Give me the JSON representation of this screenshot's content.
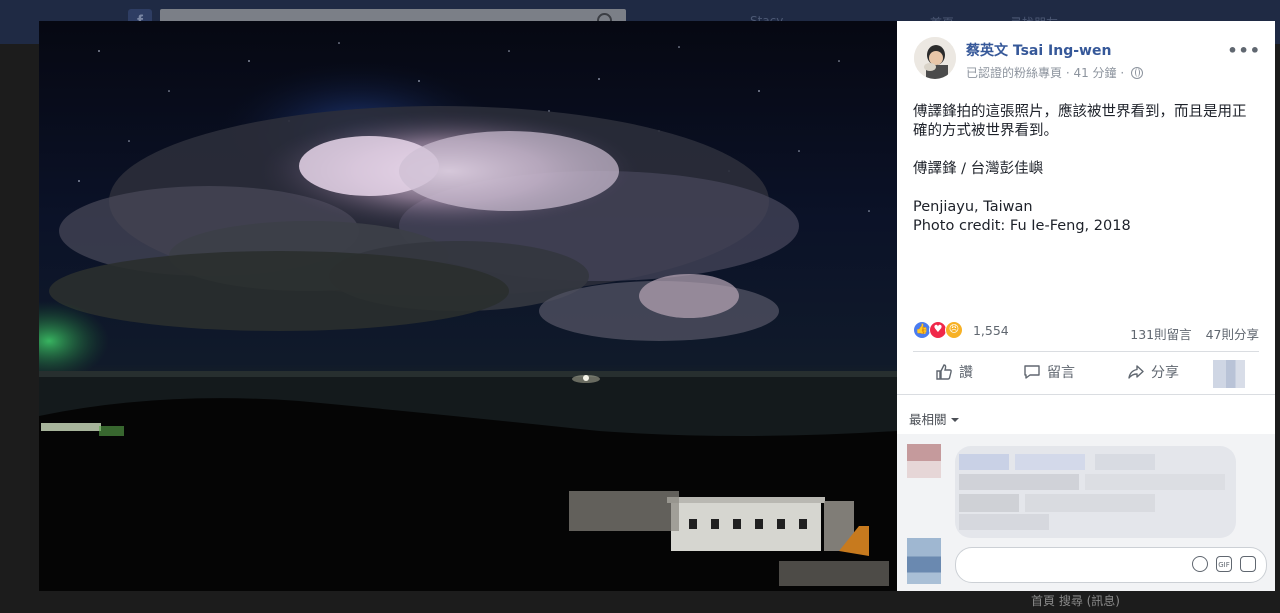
{
  "topbar": {
    "logo": "f",
    "search_placeholder": "",
    "nav": [
      "Stacy",
      "首頁",
      "尋找朋友"
    ]
  },
  "bottom": {
    "left_text": "",
    "right_text": "首頁 搜尋 (訊息)"
  },
  "post": {
    "author": "蔡英文 Tsai Ing-wen",
    "meta": "已認證的粉絲專頁 · 41 分鐘 ·",
    "paragraphs": [
      "傅譯鋒拍的這張照片，應該被世界看到，而且是用正確的方式被世界看到。",
      "傅譯鋒 / 台灣彭佳嶼",
      "Penjiayu, Taiwan\nPhoto credit: Fu Ie-Feng, 2018"
    ],
    "reaction_count": "1,554",
    "comment_count": "131則留言",
    "share_count": "47則分享",
    "actions": {
      "like": "讚",
      "comment": "留言",
      "share": "分享"
    },
    "sort_label": "最相關",
    "compose_placeholder": ""
  },
  "colors": {
    "link": "#365899",
    "reaction_like": "#4a7cf0",
    "reaction_love": "#f0284a",
    "reaction_angry": "#f7b125"
  }
}
